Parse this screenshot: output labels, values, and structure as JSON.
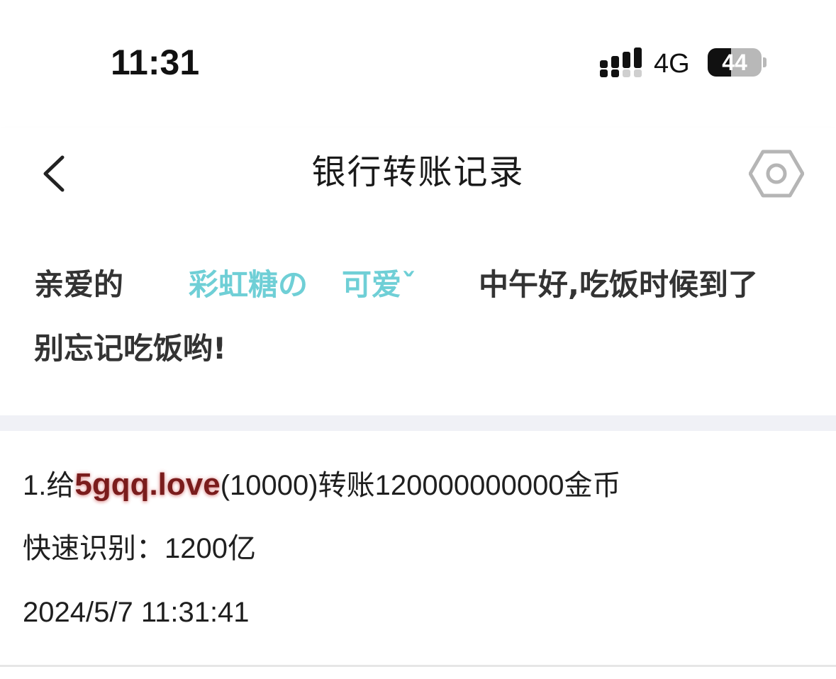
{
  "status_bar": {
    "time": "11:31",
    "network": "4G",
    "battery_level": "44",
    "battery_fraction": 0.44,
    "icons": [
      "signal-icon",
      "battery-icon"
    ]
  },
  "nav": {
    "title": "银行转账记录",
    "back_icon": "chevron-left-icon",
    "settings_icon": "hexagon-settings-icon"
  },
  "greeting": {
    "prefix": "亲爱的",
    "name_part1": "彩虹糖の",
    "name_part2": "可爱ˇ",
    "suffix": "中午好,吃饭时候到了",
    "line2": "别忘记吃饭哟!"
  },
  "record": {
    "line1_prefix": "1.给",
    "recipient": "5gqq.love",
    "line1_suffix": "(10000)转账120000000000金币",
    "quick_label": "快速识别：",
    "quick_value": "1200亿",
    "timestamp": "2024/5/7 11:31:41"
  },
  "colors": {
    "accent": "#6fcfd6",
    "recipient": "#7a1c1c",
    "separator": "#f0f1f6"
  }
}
